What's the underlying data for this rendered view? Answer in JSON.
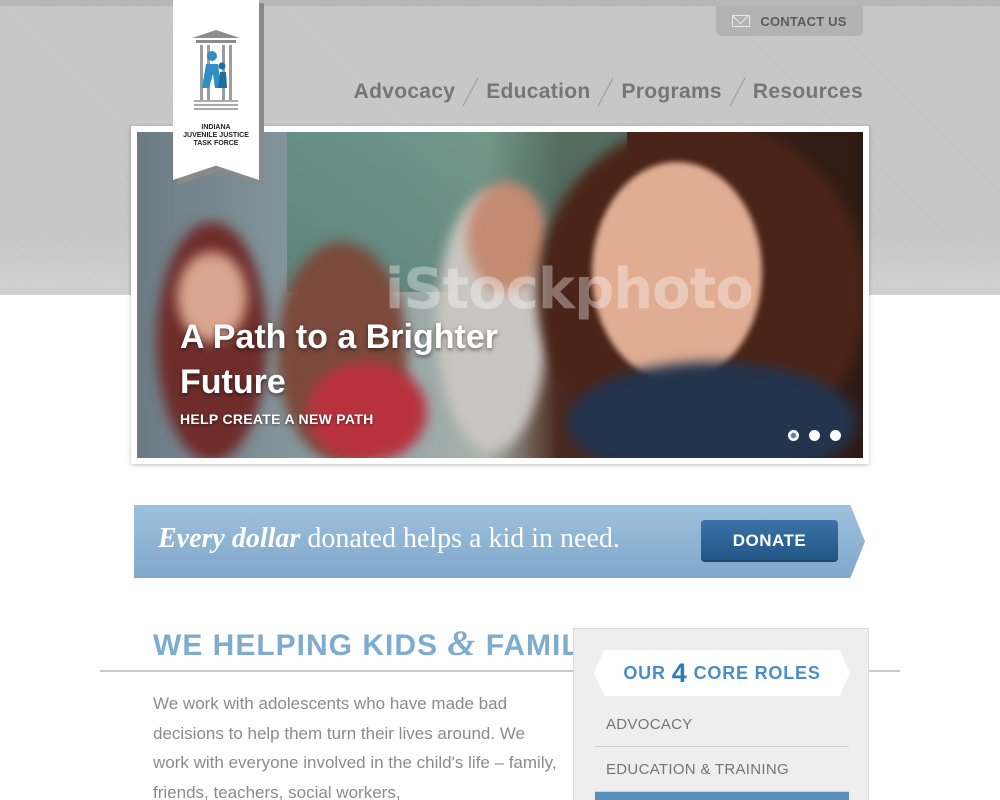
{
  "header": {
    "contact_label": "CONTACT US",
    "nav": [
      "Advocacy",
      "Education",
      "Programs",
      "Resources"
    ]
  },
  "logo": {
    "text_line1": "INDIANA",
    "text_line2": "JUVENILE JUSTICE",
    "text_line3": "TASK FORCE"
  },
  "hero": {
    "watermark": "iStockphoto",
    "title": "A Path to a Brighter Future",
    "subtitle": "HELP CREATE A NEW PATH",
    "slide_count": 3,
    "active_slide": 1
  },
  "donate": {
    "emphasis": "Every dollar",
    "message": " donated helps a kid in need.",
    "button_label": "DONATE"
  },
  "section": {
    "heading_part1": "WE HELPING KIDS ",
    "heading_amp": "&",
    "heading_part2": " FAMILIES",
    "intro": "We work with adolescents who have made bad decisions to help them turn their lives around. We work with everyone involved in the child's life – family, friends, teachers, social workers,"
  },
  "roles": {
    "title_prefix": "OUR",
    "title_number": "4",
    "title_suffix": "CORE ROLES",
    "items": [
      "ADVOCACY",
      "EDUCATION & TRAINING",
      ""
    ]
  },
  "colors": {
    "accent_blue": "#7eabd0",
    "button_blue": "#215684",
    "banner_blue": "#8fb4d4",
    "nav_gray": "#767676"
  },
  "icons": {
    "contact": "mail-icon"
  }
}
